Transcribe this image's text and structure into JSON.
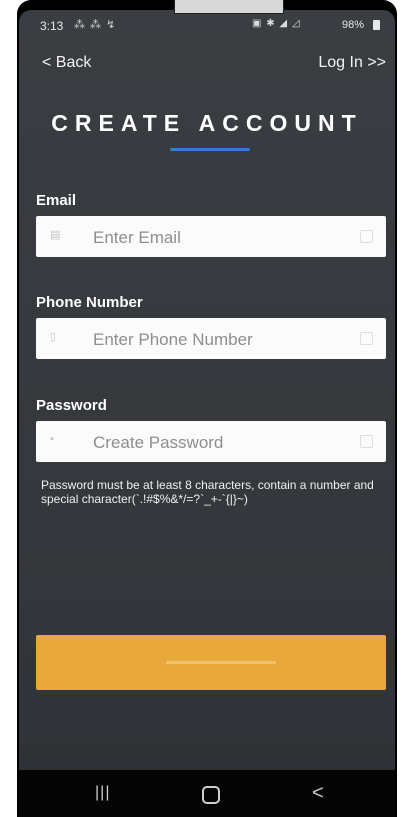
{
  "status_bar": {
    "time": "3:13",
    "left_icons": "⁂ ⁂ ↯",
    "right_icons": "▣ ✱ ◢ ◿",
    "battery_text": "98%"
  },
  "nav": {
    "back_label": "< Back",
    "login_label": "Log In >>"
  },
  "title": "CREATE ACCOUNT",
  "accent_color": "#2f7fd1",
  "fields": [
    {
      "label": "Email",
      "placeholder": "Enter Email",
      "value": "",
      "icon": "envelope-icon"
    },
    {
      "label": "Phone Number",
      "placeholder": "Enter Phone Number",
      "value": "",
      "icon": "phone-icon"
    },
    {
      "label": "Password",
      "placeholder": "Create Password",
      "value": "",
      "icon": "lock-icon"
    }
  ],
  "password_hint": "Password must be at least 8 characters, contain a number and special character(`.!#$%&*/=?`_+-`{|}~)",
  "submit_button": {
    "label": "",
    "color": "#e9a83a"
  },
  "android_nav": {
    "recents": "|||",
    "home": "",
    "back": "<"
  }
}
